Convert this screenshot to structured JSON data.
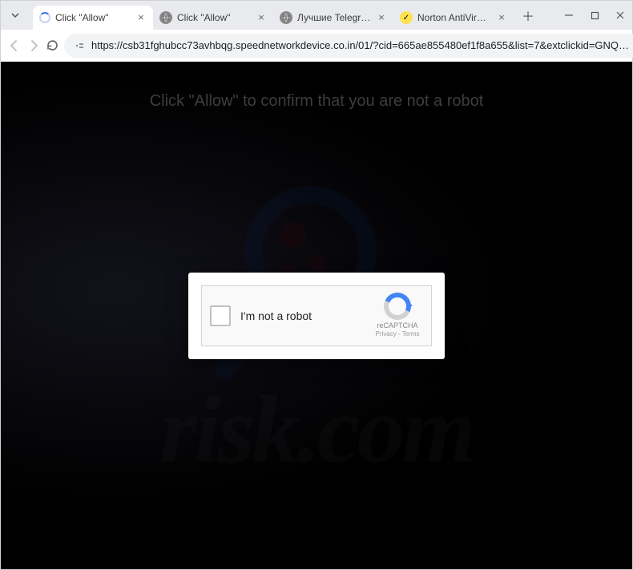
{
  "tabs": [
    {
      "title": "Click \"Allow\"",
      "favicon": "spinner",
      "active": true
    },
    {
      "title": "Click \"Allow\"",
      "favicon": "globe",
      "active": false
    },
    {
      "title": "Лучшие Telegram ка…",
      "favicon": "globe",
      "active": false
    },
    {
      "title": "Norton AntiVirus Prot…",
      "favicon": "norton",
      "active": false
    }
  ],
  "address_bar": {
    "url": "https://csb31fghubcc73avhbqg.speednetworkdevice.co.in/01/?cid=665ae855480ef1f8a655&list=7&extclickid=GNQ…"
  },
  "page": {
    "headline": "Click \"Allow\" to confirm that you are not a robot",
    "captcha": {
      "label": "I'm not a robot",
      "brand": "reCAPTCHA",
      "links": "Privacy - Terms"
    },
    "watermark_text": "risk.com"
  }
}
